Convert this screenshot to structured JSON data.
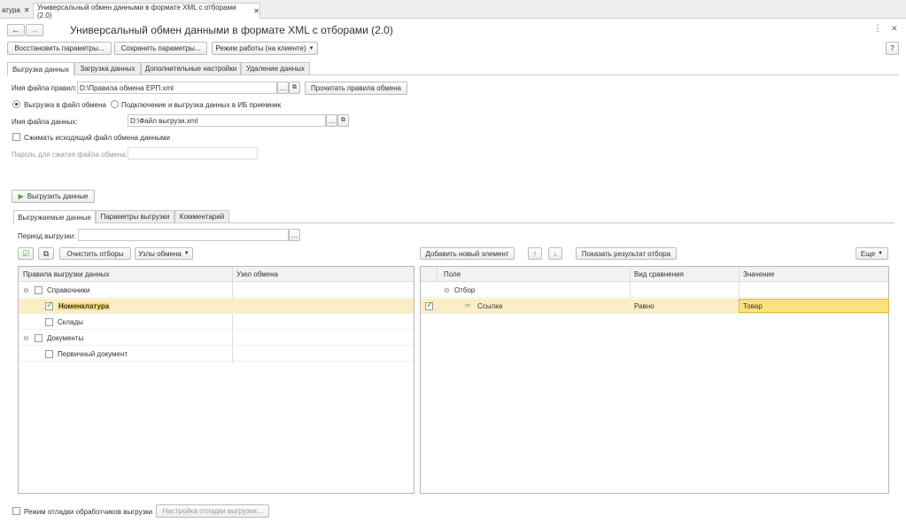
{
  "topTabs": [
    {
      "label": "атура"
    },
    {
      "label": "Универсальный обмен данными в формате XML с отборами (2.0)"
    }
  ],
  "header": {
    "title": "Универсальный обмен данными в формате XML с отборами (2.0)",
    "help": "?"
  },
  "toolbar": {
    "restore": "Восстановить параметры...",
    "save": "Сохранить параметры...",
    "mode": "Режим работы (на клиенте)"
  },
  "mainTabs": [
    "Выгрузка данных",
    "Загрузка данных",
    "Дополнительные настройки",
    "Удаление данных"
  ],
  "rules": {
    "label": "Имя файла правил:",
    "value": "D:\\Правила обмена ЕРП.xml",
    "read_button": "Прочитать правила обмена"
  },
  "radios": {
    "file": "Выгрузка в файл обмена",
    "ib": "Подключение и выгрузка данных в ИБ приемник"
  },
  "dataFile": {
    "label": "Имя файла данных:",
    "value": "D:\\Файл выгрузи.xml"
  },
  "compress": {
    "label": "Сжимать исходящий файл обмена данными"
  },
  "password": {
    "label": "Пароль для сжатия файла обмена:"
  },
  "exportButton": "Выгрузить данные",
  "innerTabs": [
    "Выгружаемые данные",
    "Параметры выгрузки",
    "Комментарий"
  ],
  "period": {
    "label": "Период выгрузки:"
  },
  "leftToolbar": {
    "clear": "Очистить отборы",
    "nodes": "Узлы обмена"
  },
  "leftGrid": {
    "columns": [
      "Правила выгрузки данных",
      "Узел обмена"
    ],
    "rows": [
      {
        "label": "Справочники"
      },
      {
        "label": "Номенклатура"
      },
      {
        "label": "Склады"
      },
      {
        "label": "Документы"
      },
      {
        "label": "Первичный документ"
      }
    ]
  },
  "rightToolbar": {
    "add": "Добавить новый элемент",
    "show": "Показать результат отбора",
    "more": "Еще"
  },
  "rightGrid": {
    "columns": [
      "Поле",
      "Вид сравнения",
      "Значение"
    ],
    "group": "Отбор",
    "row": {
      "field": "Ссылка",
      "comparison": "Равно",
      "value": "Товар"
    }
  },
  "footer": {
    "debug": "Режим отладки обработчиков выгрузки",
    "debug_settings": "Настройка отладки выгрузки..."
  },
  "colors": {
    "accent": "#4aa63a",
    "selection": "#fbeec5",
    "value_highlight": "#fbe27e",
    "value_border": "#e2b93a"
  }
}
